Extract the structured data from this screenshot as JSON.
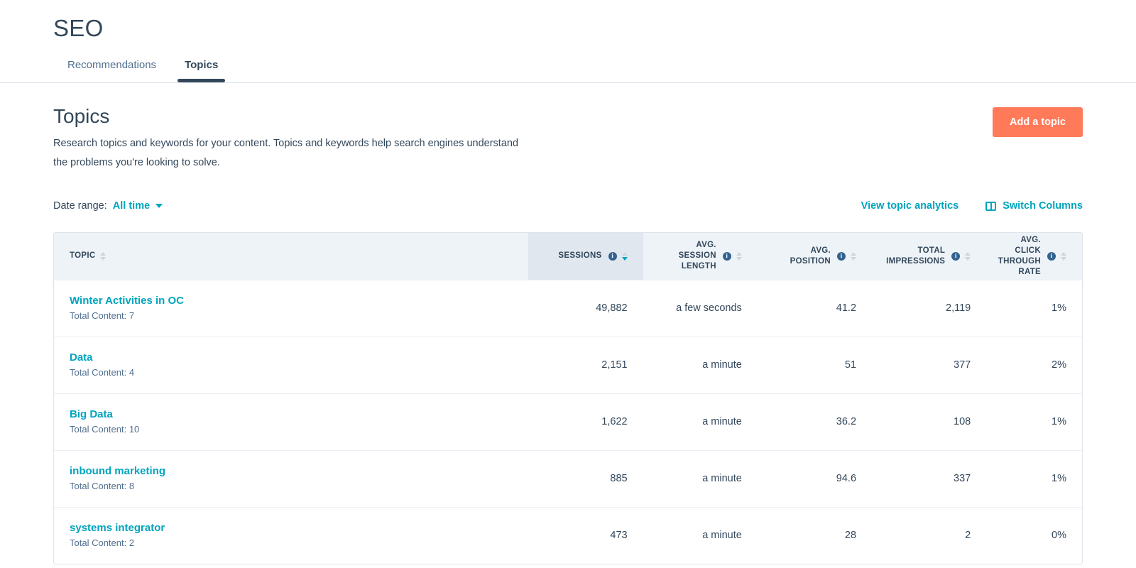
{
  "app": {
    "title": "SEO"
  },
  "tabs": [
    {
      "label": "Recommendations",
      "active": false
    },
    {
      "label": "Topics",
      "active": true
    }
  ],
  "section": {
    "title": "Topics",
    "description": "Research topics and keywords for your content. Topics and keywords help search engines understand the problems you're looking to solve.",
    "add_button": "Add a topic"
  },
  "filters": {
    "date_range_label": "Date range:",
    "date_range_value": "All time",
    "view_analytics": "View topic analytics",
    "switch_columns": "Switch Columns",
    "columns_icon": "columns-icon",
    "caret_icon": "chevron-down-icon"
  },
  "colors": {
    "accent_teal": "#00a4bd",
    "brand_orange": "#ff7a59",
    "text_navy": "#33475b",
    "header_bg": "#eef3f7",
    "active_col_bg": "#e0e7ef"
  },
  "table": {
    "columns": [
      {
        "label": "TOPIC",
        "align": "left",
        "info": false,
        "sorted": false
      },
      {
        "label": "SESSIONS",
        "align": "right",
        "info": true,
        "sorted": true,
        "direction": "desc"
      },
      {
        "label": "AVG. SESSION LENGTH",
        "align": "right",
        "info": true,
        "sorted": false
      },
      {
        "label": "AVG. POSITION",
        "align": "right",
        "info": true,
        "sorted": false
      },
      {
        "label": "TOTAL IMPRESSIONS",
        "align": "right",
        "info": true,
        "sorted": false
      },
      {
        "label": "AVG. CLICK THROUGH RATE",
        "align": "right",
        "info": true,
        "sorted": false
      }
    ],
    "rows": [
      {
        "topic": "Winter Activities in OC",
        "total_content": "Total Content: 7",
        "sessions": "49,882",
        "avg_session_length": "a few seconds",
        "avg_position": "41.2",
        "total_impressions": "2,119",
        "avg_ctr": "1%"
      },
      {
        "topic": "Data",
        "total_content": "Total Content: 4",
        "sessions": "2,151",
        "avg_session_length": "a minute",
        "avg_position": "51",
        "total_impressions": "377",
        "avg_ctr": "2%"
      },
      {
        "topic": "Big Data",
        "total_content": "Total Content: 10",
        "sessions": "1,622",
        "avg_session_length": "a minute",
        "avg_position": "36.2",
        "total_impressions": "108",
        "avg_ctr": "1%"
      },
      {
        "topic": "inbound marketing",
        "total_content": "Total Content: 8",
        "sessions": "885",
        "avg_session_length": "a minute",
        "avg_position": "94.6",
        "total_impressions": "337",
        "avg_ctr": "1%"
      },
      {
        "topic": "systems integrator",
        "total_content": "Total Content: 2",
        "sessions": "473",
        "avg_session_length": "a minute",
        "avg_position": "28",
        "total_impressions": "2",
        "avg_ctr": "0%"
      }
    ]
  }
}
